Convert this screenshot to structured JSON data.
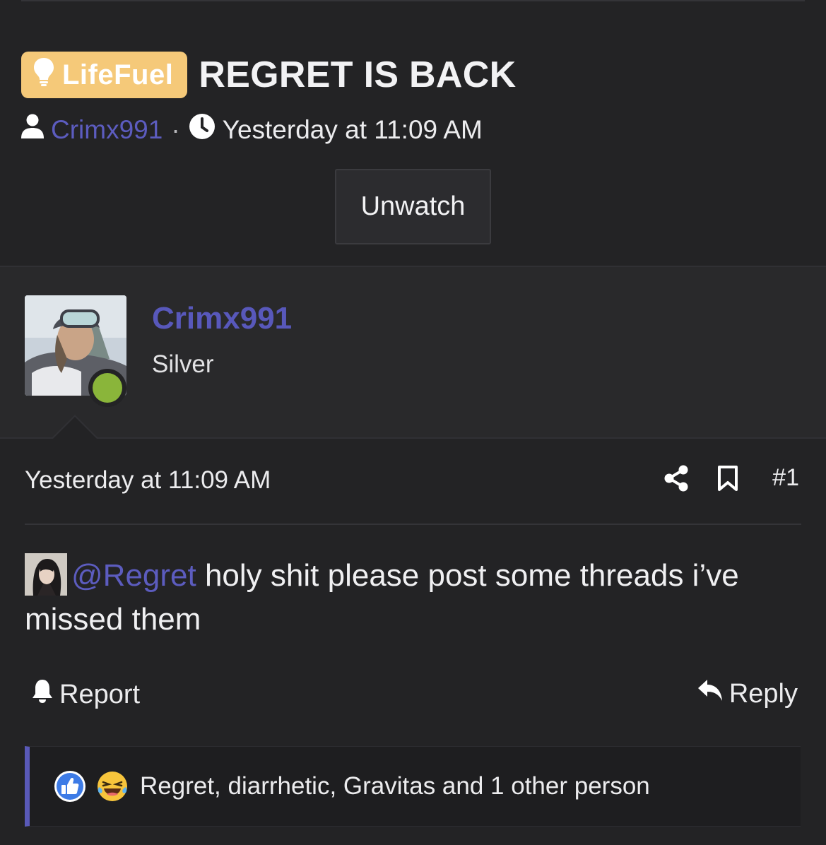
{
  "thread": {
    "prefix": "LifeFuel",
    "prefix_icon": "lightbulb-icon",
    "title": "REGRET IS BACK",
    "author": "Crimx991",
    "separator": "·",
    "started": "Yesterday at 11:09 AM",
    "watch_button": "Unwatch"
  },
  "user": {
    "name": "Crimx991",
    "title": "Silver",
    "status": "online",
    "status_color": "#8ab53a"
  },
  "post": {
    "time": "Yesterday at 11:09 AM",
    "number": "#1",
    "mention": "@Regret",
    "body": " holy shit please post some threads i’ve missed them",
    "report_label": "Report",
    "reply_label": "Reply"
  },
  "reactions": {
    "icons": [
      "like-icon",
      "laugh-icon"
    ],
    "text": "Regret, diarrhetic, Gravitas and 1 other person"
  },
  "colors": {
    "background": "#232325",
    "link": "#5c5cbf",
    "prefix_bg": "#f5c979",
    "accent_bar": "#5959b8"
  }
}
